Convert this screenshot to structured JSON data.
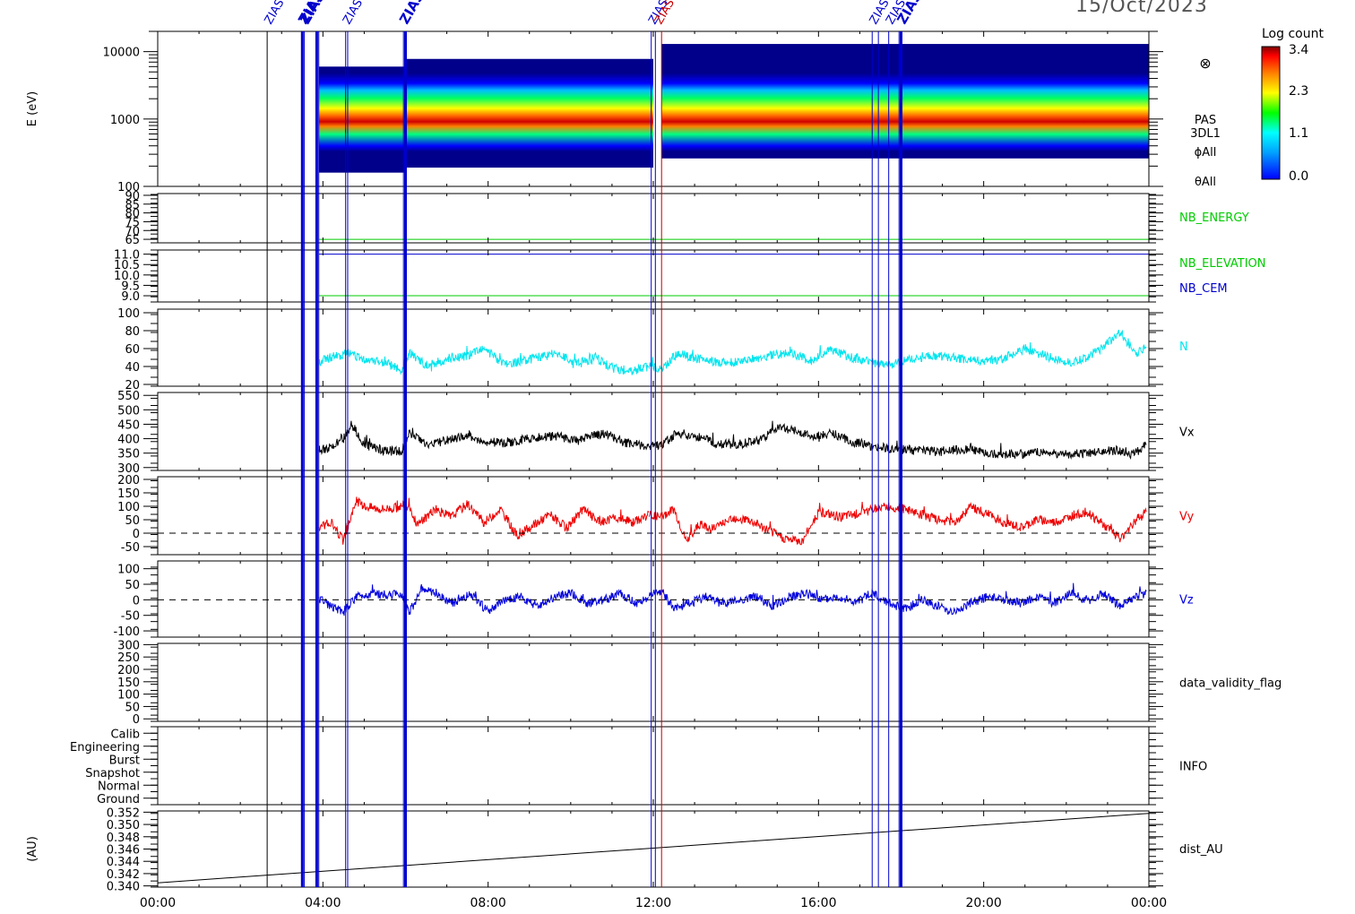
{
  "date_label": "15/Oct/2023",
  "chart_data": {
    "type": "line",
    "description_axes": "stacked time-series panels",
    "x_axis": {
      "ticks": [
        "00:00",
        "04:00",
        "08:00",
        "12:00",
        "16:00",
        "20:00",
        "00:00"
      ],
      "range_hours": [
        0,
        24
      ]
    },
    "colorbar": {
      "title": "Log count",
      "ticks": [
        "3.4",
        "2.3",
        "1.1",
        "0.0"
      ],
      "range": [
        0.0,
        3.4
      ],
      "colors": [
        "#0000ff",
        "#00ffff",
        "#00ff00",
        "#ffff00",
        "#ff8000",
        "#ff0000",
        "#800000"
      ]
    },
    "event_markers": {
      "label": "ZIAS",
      "times_hours": [
        2.65,
        3.5,
        3.55,
        3.85,
        3.9,
        4.55,
        4.6,
        5.95,
        6.0,
        11.95,
        12.05,
        12.2,
        17.3,
        17.45,
        17.7,
        17.95,
        18.0
      ],
      "bold_times_hours": [
        3.5,
        3.85,
        6.0,
        18.0
      ],
      "red_time_hours": 12.2,
      "color": "#0000cc"
    },
    "panels": [
      {
        "id": "energy",
        "kind": "spectrogram",
        "ylabel": "E (eV)",
        "yscale": "log",
        "ylim": [
          100,
          20000
        ],
        "yticks": [
          "10000",
          "1000",
          "100"
        ],
        "ytick_values": [
          10000,
          1000,
          100
        ],
        "right_labels": [
          "PAS",
          "3DL1",
          "ϕAll",
          "θAll"
        ],
        "symbol": "⊗"
      },
      {
        "id": "nb_energy",
        "ylim": [
          63,
          91
        ],
        "yticks": [
          "90",
          "85",
          "80",
          "75",
          "70",
          "65"
        ],
        "ytick_values": [
          90,
          85,
          80,
          75,
          70,
          65
        ],
        "series": [
          {
            "name": "NB_ENERGY",
            "color": "#00cc00",
            "value": 65,
            "start_h": 3.9
          }
        ]
      },
      {
        "id": "nb_elev",
        "ylim": [
          8.7,
          11.2
        ],
        "yticks": [
          "11.0",
          "10.5",
          "10.0",
          "9.5",
          "9.0"
        ],
        "ytick_values": [
          11.0,
          10.5,
          10.0,
          9.5,
          9.0
        ],
        "series": [
          {
            "name": "NB_ELEVATION",
            "color": "#00cc00",
            "value": 9.0,
            "start_h": 3.9
          },
          {
            "name": "NB_CEM",
            "color": "#0000cc",
            "value": 11.0,
            "start_h": 3.9
          }
        ]
      },
      {
        "id": "density",
        "ylim": [
          18,
          104
        ],
        "yticks": [
          "100",
          "80",
          "60",
          "40",
          "20"
        ],
        "ytick_values": [
          100,
          80,
          60,
          40,
          20
        ],
        "series": [
          {
            "name": "N",
            "color": "#00e5ee",
            "t": [
              3.9,
              4.2,
              4.6,
              5.0,
              5.5,
              5.9,
              6.1,
              6.5,
              7.0,
              7.5,
              7.9,
              8.4,
              9.0,
              9.6,
              10.2,
              10.6,
              11.0,
              11.5,
              11.9,
              12.2,
              12.6,
              13.1,
              13.6,
              14.2,
              14.8,
              15.3,
              15.8,
              16.3,
              16.8,
              17.3,
              17.8,
              18.2,
              18.8,
              19.3,
              19.8,
              20.4,
              21.0,
              21.5,
              22.0,
              22.5,
              22.9,
              23.3,
              23.7,
              23.95
            ],
            "y": [
              45,
              50,
              55,
              48,
              44,
              36,
              55,
              42,
              47,
              52,
              60,
              42,
              48,
              54,
              44,
              50,
              38,
              35,
              40,
              38,
              55,
              48,
              44,
              46,
              52,
              56,
              46,
              58,
              50,
              44,
              42,
              48,
              52,
              50,
              46,
              48,
              60,
              52,
              44,
              50,
              62,
              78,
              55,
              62
            ]
          }
        ]
      },
      {
        "id": "vx",
        "ylim": [
          290,
          560
        ],
        "yticks": [
          "550",
          "500",
          "450",
          "400",
          "350",
          "300"
        ],
        "ytick_values": [
          550,
          500,
          450,
          400,
          350,
          300
        ],
        "series": [
          {
            "name": "Vx",
            "color": "#000000",
            "t": [
              3.9,
              4.2,
              4.5,
              4.7,
              5.0,
              5.4,
              5.9,
              6.1,
              6.5,
              7.0,
              7.5,
              7.9,
              8.4,
              9.0,
              9.6,
              10.2,
              10.8,
              11.3,
              11.9,
              12.2,
              12.6,
              13.0,
              13.5,
              14.0,
              14.6,
              15.0,
              15.4,
              15.9,
              16.3,
              16.8,
              17.3,
              17.8,
              18.3,
              18.9,
              19.5,
              20.1,
              20.8,
              21.4,
              22.0,
              22.6,
              23.2,
              23.6,
              23.95
            ],
            "y": [
              360,
              370,
              400,
              450,
              380,
              360,
              355,
              420,
              380,
              395,
              410,
              390,
              385,
              400,
              410,
              395,
              420,
              385,
              375,
              380,
              420,
              410,
              385,
              380,
              395,
              440,
              430,
              405,
              420,
              390,
              375,
              365,
              360,
              355,
              365,
              350,
              345,
              355,
              345,
              350,
              360,
              345,
              380
            ]
          }
        ]
      },
      {
        "id": "vy",
        "ylim": [
          -80,
          210
        ],
        "yticks": [
          "200",
          "150",
          "100",
          "50",
          "0",
          "-50"
        ],
        "ytick_values": [
          200,
          150,
          100,
          50,
          0,
          -50
        ],
        "zero_line": true,
        "series": [
          {
            "name": "Vy",
            "color": "#ee0000",
            "t": [
              3.9,
              4.2,
              4.5,
              4.8,
              5.0,
              5.4,
              5.8,
              6.0,
              6.3,
              6.7,
              7.1,
              7.5,
              7.9,
              8.3,
              8.7,
              9.1,
              9.5,
              9.9,
              10.3,
              10.7,
              11.1,
              11.5,
              11.9,
              12.2,
              12.5,
              12.8,
              13.1,
              13.5,
              13.9,
              14.3,
              14.8,
              15.2,
              15.6,
              16.0,
              16.5,
              16.9,
              17.3,
              17.7,
              18.1,
              18.5,
              18.9,
              19.3,
              19.7,
              20.1,
              20.5,
              20.9,
              21.3,
              21.7,
              22.1,
              22.5,
              22.9,
              23.3,
              23.7,
              23.95
            ],
            "y": [
              20,
              40,
              -30,
              120,
              100,
              90,
              95,
              110,
              30,
              90,
              60,
              110,
              40,
              90,
              -10,
              30,
              70,
              20,
              90,
              40,
              60,
              40,
              70,
              60,
              90,
              -30,
              30,
              20,
              60,
              50,
              10,
              -20,
              -30,
              80,
              60,
              70,
              90,
              100,
              90,
              70,
              50,
              40,
              100,
              70,
              40,
              20,
              50,
              40,
              60,
              80,
              30,
              -20,
              50,
              90
            ]
          }
        ]
      },
      {
        "id": "vz",
        "ylim": [
          -120,
          125
        ],
        "yticks": [
          "100",
          "50",
          "0",
          "-50",
          "-100"
        ],
        "ytick_values": [
          100,
          50,
          0,
          -50,
          -100
        ],
        "zero_line": true,
        "series": [
          {
            "name": "Vz",
            "color": "#0000dd",
            "t": [
              3.9,
              4.2,
              4.5,
              4.8,
              5.2,
              5.6,
              5.9,
              6.1,
              6.4,
              6.8,
              7.2,
              7.6,
              8.0,
              8.4,
              8.8,
              9.2,
              9.6,
              10.0,
              10.4,
              10.8,
              11.2,
              11.6,
              11.9,
              12.2,
              12.5,
              12.9,
              13.3,
              13.7,
              14.1,
              14.5,
              14.9,
              15.3,
              15.7,
              16.1,
              16.5,
              16.9,
              17.3,
              17.7,
              18.1,
              18.5,
              18.9,
              19.3,
              19.7,
              20.1,
              20.5,
              20.9,
              21.3,
              21.7,
              22.1,
              22.5,
              22.9,
              23.3,
              23.7,
              23.95
            ],
            "y": [
              0,
              -20,
              -40,
              10,
              20,
              15,
              20,
              -40,
              40,
              10,
              -10,
              20,
              -40,
              0,
              10,
              -20,
              10,
              20,
              -10,
              0,
              20,
              -10,
              10,
              30,
              -30,
              -10,
              10,
              -10,
              0,
              10,
              -20,
              10,
              20,
              0,
              10,
              -10,
              20,
              -10,
              -30,
              0,
              -20,
              -40,
              -10,
              10,
              0,
              -10,
              10,
              -10,
              20,
              0,
              20,
              -20,
              10,
              20
            ]
          }
        ]
      },
      {
        "id": "validity",
        "ylim": [
          -10,
          305
        ],
        "yticks": [
          "300",
          "250",
          "200",
          "150",
          "100",
          "50",
          "0"
        ],
        "ytick_values": [
          300,
          250,
          200,
          150,
          100,
          50,
          0
        ],
        "right_label": "data_validity_flag"
      },
      {
        "id": "info",
        "ylim": [
          -0.5,
          5.5
        ],
        "yticks": [
          "Calib",
          "Engineering",
          "Burst",
          "Snapshot",
          "Normal",
          "Ground"
        ],
        "ytick_values": [
          5,
          4,
          3,
          2,
          1,
          0
        ],
        "right_label": "INFO"
      },
      {
        "id": "dist",
        "ylabel": "(AU)",
        "ylim": [
          0.3398,
          0.3522
        ],
        "yticks": [
          "0.352",
          "0.350",
          "0.348",
          "0.346",
          "0.344",
          "0.342",
          "0.340"
        ],
        "ytick_values": [
          0.352,
          0.35,
          0.348,
          0.346,
          0.344,
          0.342,
          0.34
        ],
        "series": [
          {
            "name": "dist_AU",
            "color": "#000000",
            "t": [
              0,
              24
            ],
            "y": [
              0.3405,
              0.3518
            ]
          }
        ]
      }
    ]
  }
}
